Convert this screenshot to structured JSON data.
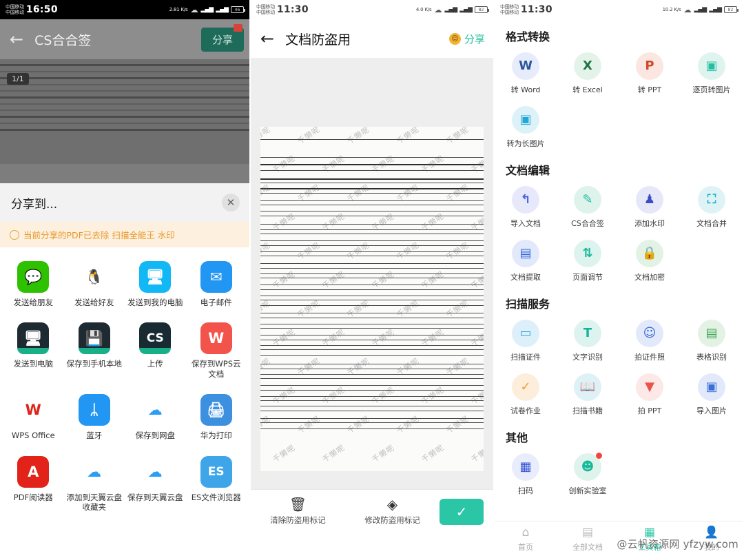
{
  "left": {
    "statusbar": {
      "carrier": "中国移动\n中国移动",
      "time": "16:50",
      "net_speed": "2.81\nK/s",
      "wifi": "wifi-icon",
      "signal1": "4G",
      "signal2": "4G",
      "battery": "46"
    },
    "appbar": {
      "back": "back-arrow-icon",
      "title": "CS合合签",
      "share_label": "分享",
      "badge": ""
    },
    "document": {
      "page_indicator": "1/1"
    },
    "sheet": {
      "title": "分享到...",
      "close": "close-icon",
      "tip": "当前分享的PDF已去除 扫描全能王 水印",
      "apps": [
        {
          "label": "发送给朋友",
          "icon": "wechat-icon",
          "color": "#2dc100"
        },
        {
          "label": "发送给好友",
          "icon": "qq-icon",
          "color": "#ffffff"
        },
        {
          "label": "发送到我的电脑",
          "icon": "my-computer-icon",
          "color": "#12b7f5"
        },
        {
          "label": "电子邮件",
          "icon": "email-icon",
          "color": "#2196f3"
        },
        {
          "label": "发送到电脑",
          "icon": "send-to-pc-icon",
          "color": "#1e2a32"
        },
        {
          "label": "保存到手机本地",
          "icon": "save-local-icon",
          "color": "#1e2a32"
        },
        {
          "label": "上传",
          "icon": "cs-upload-icon",
          "color": "#182b33"
        },
        {
          "label": "保存到WPS云文档",
          "icon": "wps-cloud-icon",
          "color": "#f2544b"
        },
        {
          "label": "WPS Office",
          "icon": "wps-office-icon",
          "color": "#ffffff"
        },
        {
          "label": "蓝牙",
          "icon": "bluetooth-icon",
          "color": "#2196f3"
        },
        {
          "label": "保存到网盘",
          "icon": "baidu-netdisk-icon",
          "color": "#ffffff"
        },
        {
          "label": "华为打印",
          "icon": "huawei-print-icon",
          "color": "#3d8fe0"
        },
        {
          "label": "PDF阅读器",
          "icon": "pdf-reader-icon",
          "color": "#e2231a"
        },
        {
          "label": "添加到天翼云盘收藏夹",
          "icon": "tianyi-cloud-add-icon",
          "color": "#ffffff"
        },
        {
          "label": "保存到天翼云盘",
          "icon": "tianyi-cloud-save-icon",
          "color": "#ffffff"
        },
        {
          "label": "ES文件浏览器",
          "icon": "es-explorer-icon",
          "color": "#3da5e8"
        }
      ]
    }
  },
  "middle": {
    "statusbar": {
      "carrier": "中国移动\n中国移动",
      "time": "11:30",
      "net_speed": "4.0\nK/s",
      "battery": "82"
    },
    "appbar": {
      "back": "back-arrow-icon",
      "title": "文档防盗用",
      "share_label": "分享",
      "share_icon": "smiley-icon"
    },
    "document": {
      "watermark_text": "千懒呢"
    },
    "bottom": {
      "clear_label": "清除防盗用标记",
      "clear_icon": "trash-icon",
      "modify_label": "修改防盗用标记",
      "modify_icon": "stamp-icon",
      "confirm_icon": "check-icon",
      "confirm_color": "#2ac6a5"
    }
  },
  "right": {
    "statusbar": {
      "carrier": "中国移动\n中国移动",
      "time": "11:30",
      "net_speed": "10.2\nK/s",
      "battery": "82"
    },
    "sections": [
      {
        "title": "格式转换",
        "items": [
          {
            "label": "转 Word",
            "icon": "word-icon",
            "bg": "#e6ecfb",
            "fg": "#2b579a",
            "glyph": "W"
          },
          {
            "label": "转 Excel",
            "icon": "excel-icon",
            "bg": "#e4f3ea",
            "fg": "#217346",
            "glyph": "X"
          },
          {
            "label": "转 PPT",
            "icon": "ppt-icon",
            "bg": "#fbe6e2",
            "fg": "#d24726",
            "glyph": "P"
          },
          {
            "label": "逐页转图片",
            "icon": "page-to-image-icon",
            "bg": "#dff4ef",
            "fg": "#24bfa0",
            "glyph": "▣"
          },
          {
            "label": "转为长图片",
            "icon": "long-image-icon",
            "bg": "#ddf2f8",
            "fg": "#1ea7d8",
            "glyph": "▣"
          }
        ]
      },
      {
        "title": "文档编辑",
        "items": [
          {
            "label": "导入文档",
            "icon": "import-doc-icon",
            "bg": "#e7e9fb",
            "fg": "#4a63e7",
            "glyph": "↰"
          },
          {
            "label": "CS合合签",
            "icon": "cs-sign-icon",
            "bg": "#ddf3ec",
            "fg": "#24bfa0",
            "glyph": "✎"
          },
          {
            "label": "添加水印",
            "icon": "watermark-icon",
            "bg": "#e6e8fa",
            "fg": "#3b4fc4",
            "glyph": "♟"
          },
          {
            "label": "文档合并",
            "icon": "merge-doc-icon",
            "bg": "#dff3f7",
            "fg": "#1fb6c9",
            "glyph": "⛶"
          },
          {
            "label": "文档提取",
            "icon": "extract-doc-icon",
            "bg": "#e2e9fb",
            "fg": "#2f66d8",
            "glyph": "▤"
          },
          {
            "label": "页面调节",
            "icon": "page-adjust-icon",
            "bg": "#ddf3ee",
            "fg": "#17b99a",
            "glyph": "⇅"
          },
          {
            "label": "文档加密",
            "icon": "encrypt-doc-icon",
            "bg": "#e2f2e4",
            "fg": "#2aa84a",
            "glyph": "🔒"
          }
        ]
      },
      {
        "title": "扫描服务",
        "items": [
          {
            "label": "扫描证件",
            "icon": "scan-id-icon",
            "bg": "#ddf0fa",
            "fg": "#2aa3e0",
            "glyph": "▭"
          },
          {
            "label": "文字识别",
            "icon": "ocr-text-icon",
            "bg": "#ddf3ef",
            "fg": "#13b39a",
            "glyph": "T"
          },
          {
            "label": "拍证件照",
            "icon": "id-photo-icon",
            "bg": "#e2e9fb",
            "fg": "#2f66d8",
            "glyph": "☺"
          },
          {
            "label": "表格识别",
            "icon": "table-ocr-icon",
            "bg": "#e4f2e6",
            "fg": "#37a84e",
            "glyph": "▤"
          },
          {
            "label": "试卷作业",
            "icon": "exam-paper-icon",
            "bg": "#fdeedb",
            "fg": "#f0a02c",
            "glyph": "✓"
          },
          {
            "label": "扫描书籍",
            "icon": "scan-book-icon",
            "bg": "#ddf1f6",
            "fg": "#18a9be",
            "glyph": "📖"
          },
          {
            "label": "拍 PPT",
            "icon": "capture-ppt-icon",
            "bg": "#fce8e6",
            "fg": "#e8554a",
            "glyph": "▼"
          },
          {
            "label": "导入图片",
            "icon": "import-image-icon",
            "bg": "#e2e9fb",
            "fg": "#3b6fd8",
            "glyph": "▣"
          }
        ]
      },
      {
        "title": "其他",
        "items": [
          {
            "label": "扫码",
            "icon": "qr-scan-icon",
            "bg": "#e8ecfb",
            "fg": "#3352d8",
            "glyph": "▦"
          },
          {
            "label": "创新实验室",
            "icon": "lab-icon",
            "bg": "#ddf3ec",
            "fg": "#17b99a",
            "glyph": "☻",
            "dot": true
          }
        ]
      }
    ],
    "tabbar": [
      {
        "label": "首页",
        "icon": "home-icon",
        "active": false
      },
      {
        "label": "全部文档",
        "icon": "docs-icon",
        "active": false
      },
      {
        "label": "工具箱",
        "icon": "toolbox-icon",
        "active": true
      },
      {
        "label": "我的",
        "icon": "profile-icon",
        "active": false
      }
    ],
    "watermark": "@云帆资源网 yfzyw.com"
  }
}
